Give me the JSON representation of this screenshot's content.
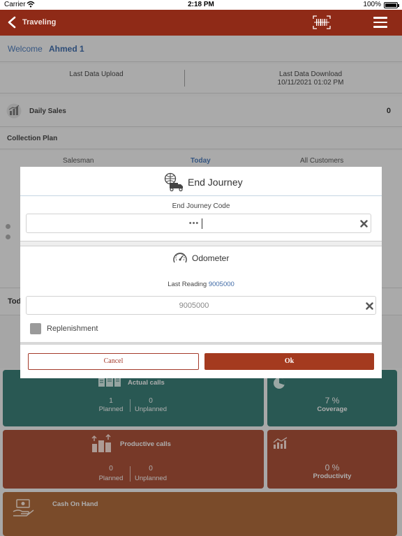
{
  "status_bar": {
    "carrier": "Carrier",
    "time": "2:18 PM",
    "battery": "100%"
  },
  "header": {
    "title": "Traveling"
  },
  "welcome": {
    "label": "Welcome",
    "name": "Ahmed 1"
  },
  "sync": {
    "upload_label": "Last Data Upload",
    "download_label": "Last Data Download",
    "download_value": "10/11/2021 01:02 PM"
  },
  "daily_sales": {
    "label": "Daily Sales",
    "value": "0"
  },
  "collection_plan": {
    "label": "Collection Plan"
  },
  "tabs": {
    "salesman": "Salesman",
    "today": "Today",
    "all_customers": "All Customers"
  },
  "today_row": {
    "label": "Tod"
  },
  "tiles": {
    "actual_calls": {
      "title": "Actual calls",
      "planned_value": "1",
      "planned_label": "Planned",
      "unplanned_value": "0",
      "unplanned_label": "Unplanned"
    },
    "coverage": {
      "value": "7 %",
      "label": "Coverage"
    },
    "productive_calls": {
      "title": "Productive calls",
      "planned_value": "0",
      "planned_label": "Planned",
      "unplanned_value": "0",
      "unplanned_label": "Unplanned"
    },
    "productivity": {
      "value": "0 %",
      "label": "Productivity"
    },
    "cash_on_hand": {
      "title": "Cash On Hand"
    }
  },
  "modal": {
    "title": "End Journey",
    "code_label": "End Journey Code",
    "code_value": "•••",
    "odometer_title": "Odometer",
    "last_reading_label": "Last Reading",
    "last_reading_value": "9005000",
    "odometer_placeholder": "9005000",
    "replenishment_label": "Replenishment",
    "cancel_label": "Cancel",
    "ok_label": "Ok"
  },
  "colors": {
    "header": "#8f2a17",
    "accent_blue": "#3f6aa6",
    "tile_teal": "#3a7b73",
    "tile_red": "#a54f38",
    "tile_orange": "#a9683b",
    "button_red": "#a43a1f"
  }
}
